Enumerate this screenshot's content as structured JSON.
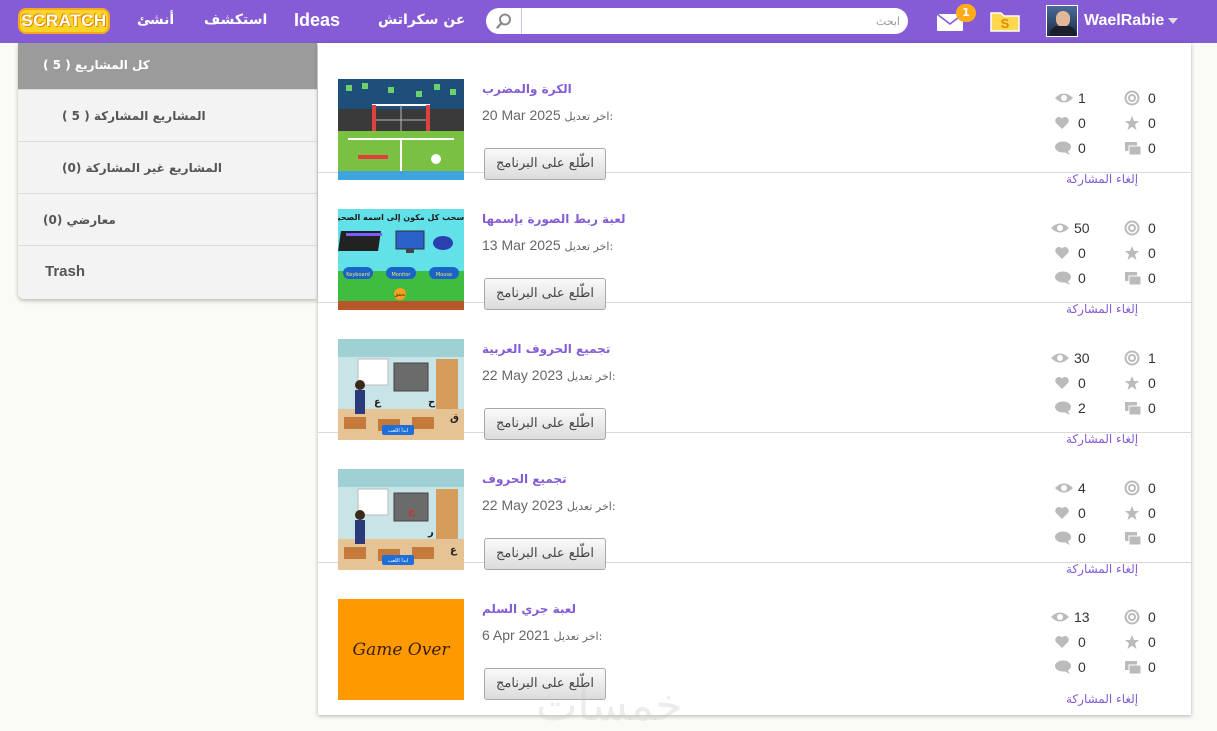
{
  "navbar": {
    "logo": "SCRATCH",
    "links": {
      "create": "أنشئ",
      "explore": "استكشف",
      "ideas": "Ideas",
      "about": "عن سكراتش"
    },
    "search_placeholder": "ابحث",
    "messages_count": "1",
    "username": "WaelRabie"
  },
  "sidebar": {
    "items": [
      {
        "label": "كل المشاريع ( 5 )"
      },
      {
        "label": "المشاريع المشاركة ( 5 )"
      },
      {
        "label": "المشاريع غير المشاركة (0)"
      },
      {
        "label": "معارضي (0)"
      },
      {
        "label": "Trash"
      }
    ]
  },
  "projects": [
    {
      "title": "الكرة والمضرب",
      "modified_label": "اخر تعديل:",
      "modified_date": "20 Mar 2025",
      "views": "1",
      "remixes": "0",
      "loves": "0",
      "favorites": "0",
      "comments": "0",
      "studios": "0"
    },
    {
      "title": "لعبة ربط الصورة بإسمها",
      "modified_label": "اخر تعديل:",
      "modified_date": "13 Mar 2025",
      "views": "50",
      "remixes": "0",
      "loves": "0",
      "favorites": "0",
      "comments": "0",
      "studios": "0"
    },
    {
      "title": "تجميع الحروف العربية",
      "modified_label": "اخر تعديل:",
      "modified_date": "22 May 2023",
      "views": "30",
      "remixes": "1",
      "loves": "0",
      "favorites": "0",
      "comments": "2",
      "studios": "0"
    },
    {
      "title": "تجميع الحروف",
      "modified_label": "اخر تعديل:",
      "modified_date": "22 May 2023",
      "views": "4",
      "remixes": "0",
      "loves": "0",
      "favorites": "0",
      "comments": "0",
      "studios": "0"
    },
    {
      "title": "لعبة جري السلم",
      "modified_label": "اخر تعديل:",
      "modified_date": "6 Apr 2021",
      "views": "13",
      "remixes": "0",
      "loves": "0",
      "favorites": "0",
      "comments": "0",
      "studios": "0"
    }
  ],
  "project_labels": {
    "see_inside": "اطّلع على البرنامج",
    "unshare": "إلغاء المشاركة"
  },
  "thumb_texts": {
    "matching_game_heading": "اسحب كل مكون إلى اسمه الصحيح:",
    "matching_game_labels": [
      "Keyboard",
      "Monitor",
      "Mouse"
    ],
    "matching_game_check": "تحقق",
    "letters_game_button_1": "ابدأ اللعب",
    "letters_game_button_2": "ابدأ اللعب",
    "game_over": "Game Over"
  },
  "watermark": "خمسات",
  "colors": {
    "brand": "#855cd6",
    "sidebar_active": "#9b9b9b",
    "badge": "#ffab1a"
  }
}
